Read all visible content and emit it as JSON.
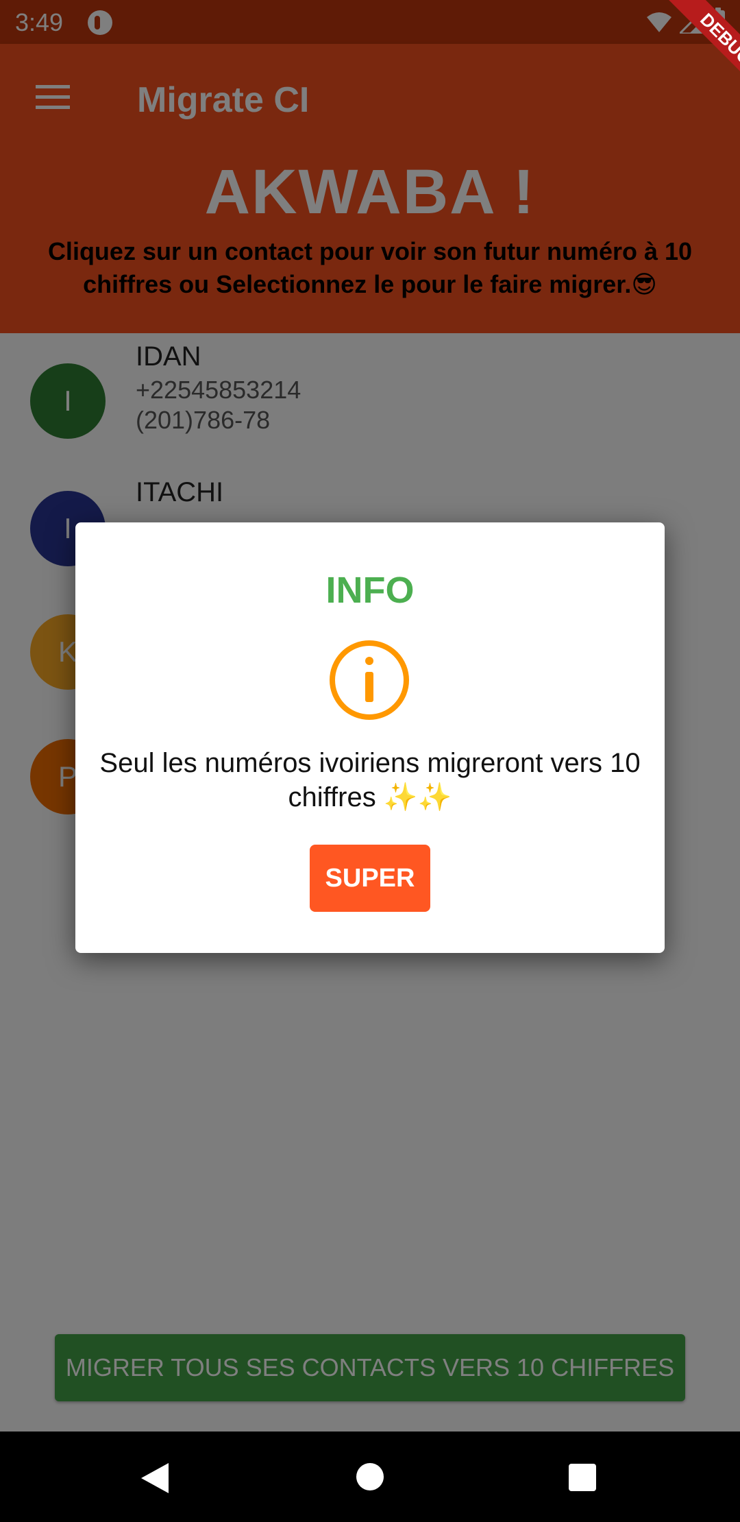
{
  "status_bar": {
    "time": "3:49",
    "icons": [
      "app-notification-icon",
      "wifi-icon",
      "signal-icon",
      "battery-icon"
    ]
  },
  "debug_banner": "DEBUG",
  "app_bar": {
    "title": "Migrate CI",
    "menu_icon": "hamburger-menu-icon"
  },
  "header": {
    "title": "AKWABA !",
    "subtitle": "Cliquez sur un contact pour voir son futur numéro à 10 chiffres ou Selectionnez le pour le faire migrer.😎"
  },
  "contacts": [
    {
      "initial": "I",
      "name": "IDAN",
      "phone": "+22545853214",
      "phone2": "(201)786-78",
      "color": "#2e7d32"
    },
    {
      "initial": "I",
      "name": "ITACHI",
      "phone": "",
      "phone2": "",
      "color": "#283593"
    },
    {
      "initial": "K",
      "name": "",
      "phone": "",
      "phone2": "",
      "color": "#f9a825"
    },
    {
      "initial": "P",
      "name": "",
      "phone": "",
      "phone2": "",
      "color": "#ef6c00"
    }
  ],
  "migrate_button": "MIGRER TOUS SES CONTACTS VERS 10 CHIFFRES",
  "dialog": {
    "title": "INFO",
    "icon": "info-icon",
    "message": "Seul les numéros ivoiriens migreront vers 10 chiffres ✨✨",
    "button": "SUPER"
  },
  "colors": {
    "primary": "#f4511e",
    "status_bar": "#bf360c",
    "dialog_title": "#4caf50",
    "info_icon": "#ff9800",
    "dialog_button": "#ff5722",
    "migrate_button": "#43a047"
  }
}
